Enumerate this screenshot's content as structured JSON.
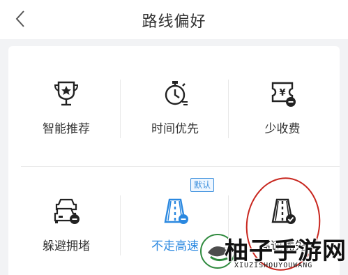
{
  "header": {
    "title": "路线偏好",
    "back_icon": "chevron-left-icon"
  },
  "options": [
    {
      "label": "智能推荐",
      "icon": "trophy-star-icon",
      "selected": false
    },
    {
      "label": "时间优先",
      "icon": "stopwatch-icon",
      "selected": false
    },
    {
      "label": "少收费",
      "icon": "toll-ticket-minus-icon",
      "selected": false
    },
    {
      "label": "躲避拥堵",
      "icon": "stacked-cars-minus-icon",
      "selected": false
    },
    {
      "label": "不走高速",
      "icon": "highway-minus-icon",
      "selected": true
    },
    {
      "label": "高速优先",
      "icon": "highway-check-icon",
      "selected": false
    }
  ],
  "badge": {
    "label": "默认"
  },
  "colors": {
    "accent": "#2a88e0",
    "text": "#333333",
    "background": "#f2f3f5",
    "annotation": "#c8261e"
  },
  "watermark": {
    "text": "柚子手游网",
    "subtext": "XIUZISHOUYOUWANG"
  }
}
